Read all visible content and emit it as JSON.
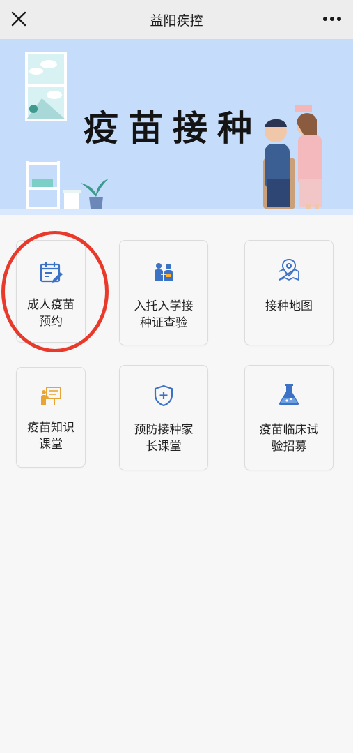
{
  "header": {
    "title": "益阳疾控",
    "close_icon": "close-icon",
    "more_icon": "more-dots-icon"
  },
  "banner": {
    "title": "疫苗接种"
  },
  "tiles": [
    {
      "line1": "成人疫苗",
      "line2": "预约",
      "icon": "calendar-edit-icon",
      "color": "#3b72c6"
    },
    {
      "line1": "入托入学接",
      "line2": "种证查验",
      "icon": "doctor-patient-icon",
      "color": "#3b72c6"
    },
    {
      "line1": "接种地图",
      "line2": "",
      "icon": "map-pin-icon",
      "color": "#3b72c6"
    },
    {
      "line1": "疫苗知识",
      "line2": "课堂",
      "icon": "teacher-board-icon",
      "color": "#e9a534"
    },
    {
      "line1": "预防接种家",
      "line2": "长课堂",
      "icon": "shield-plus-icon",
      "color": "#3b72c6"
    },
    {
      "line1": "疫苗临床试",
      "line2": "验招募",
      "icon": "flask-icon",
      "color": "#3b72c6"
    }
  ],
  "annotation": {
    "color": "#e8392b"
  }
}
